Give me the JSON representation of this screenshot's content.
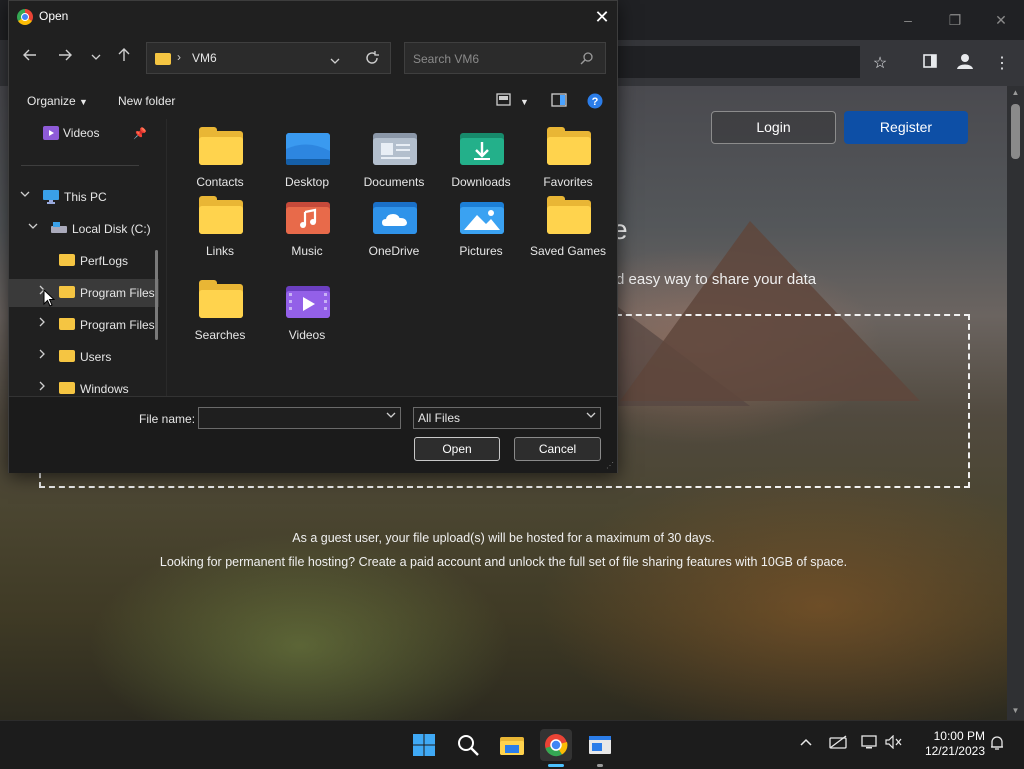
{
  "browser": {
    "window_controls": [
      "–",
      "❐",
      "✕"
    ],
    "toolbar_icons": [
      "star-icon",
      "sidebar-icon",
      "profile-icon",
      "menu-icon"
    ]
  },
  "page": {
    "login_label": "Login",
    "register_label": "Register",
    "hero_title_tail": "e",
    "hero_subtitle_tail": "d easy way to share your data",
    "guest_note": "As a guest user, your file upload(s) will be hosted for a maximum of 30 days.",
    "permanent_note": "Looking for permanent file hosting? Create a paid account and unlock the full set of file sharing features with 10GB of space."
  },
  "dialog": {
    "title": "Open",
    "address_path": "VM6",
    "search_placeholder": "Search VM6",
    "commands": {
      "organize": "Organize",
      "new_folder": "New folder"
    },
    "nav_items": [
      {
        "label": "Videos",
        "pinned": true
      },
      {
        "label": "This PC",
        "expanded": true
      },
      {
        "label": "Local Disk (C:)",
        "expanded": true
      },
      {
        "label": "PerfLogs"
      },
      {
        "label": "Program Files",
        "selected": true
      },
      {
        "label": "Program Files"
      },
      {
        "label": "Users"
      },
      {
        "label": "Windows"
      }
    ],
    "files": [
      {
        "name": "Contacts",
        "icon": "folder-icon"
      },
      {
        "name": "Desktop",
        "icon": "desktop-folder-icon"
      },
      {
        "name": "Documents",
        "icon": "documents-folder-icon"
      },
      {
        "name": "Downloads",
        "icon": "downloads-folder-icon"
      },
      {
        "name": "Favorites",
        "icon": "folder-icon"
      },
      {
        "name": "Links",
        "icon": "folder-icon"
      },
      {
        "name": "Music",
        "icon": "music-folder-icon"
      },
      {
        "name": "OneDrive",
        "icon": "onedrive-folder-icon"
      },
      {
        "name": "Pictures",
        "icon": "pictures-folder-icon"
      },
      {
        "name": "Saved Games",
        "icon": "folder-icon"
      },
      {
        "name": "Searches",
        "icon": "folder-icon"
      },
      {
        "name": "Videos",
        "icon": "videos-folder-icon"
      }
    ],
    "file_name_label": "File name:",
    "file_name_value": "",
    "file_type": "All Files",
    "open_label": "Open",
    "cancel_label": "Cancel"
  },
  "taskbar": {
    "time": "10:00 PM",
    "date": "12/21/2023"
  },
  "colors": {
    "accent": "#0d4fa6",
    "folder": "#ffd34d",
    "dialog_bg": "#202020"
  }
}
